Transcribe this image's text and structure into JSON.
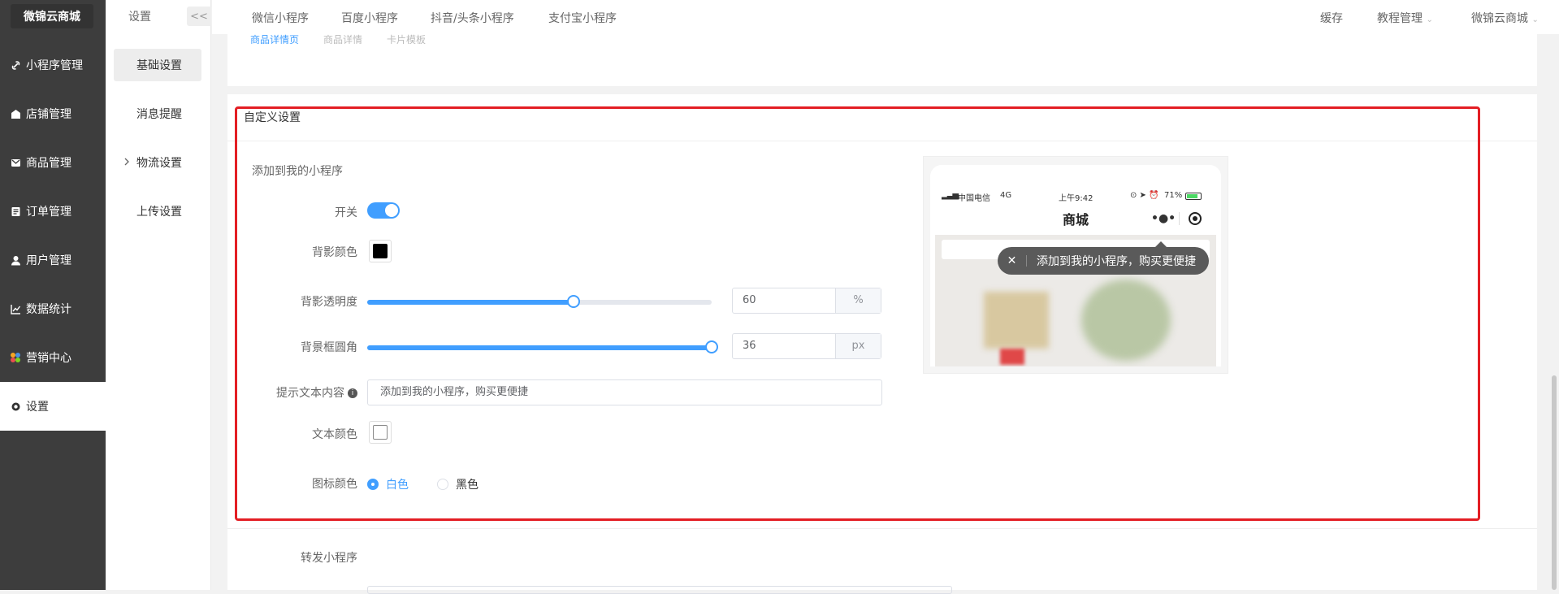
{
  "app": {
    "brand": "微锦云商城"
  },
  "sidebar": {
    "items": [
      {
        "label": "小程序管理",
        "icon": "link-icon"
      },
      {
        "label": "店铺管理",
        "icon": "store-icon"
      },
      {
        "label": "商品管理",
        "icon": "goods-icon"
      },
      {
        "label": "订单管理",
        "icon": "order-icon"
      },
      {
        "label": "用户管理",
        "icon": "user-icon"
      },
      {
        "label": "数据统计",
        "icon": "chart-icon"
      },
      {
        "label": "营销中心",
        "icon": "marketing-icon"
      },
      {
        "label": "设置",
        "icon": "gear-icon"
      }
    ]
  },
  "secondary": {
    "title": "设置",
    "collapse": "<<",
    "items": [
      {
        "label": "基础设置"
      },
      {
        "label": "消息提醒"
      },
      {
        "label": "物流设置"
      },
      {
        "label": "上传设置"
      }
    ]
  },
  "topbar": {
    "tabs": [
      "微信小程序",
      "百度小程序",
      "抖音/头条小程序",
      "支付宝小程序"
    ],
    "right": [
      "缓存",
      "教程管理",
      "微锦云商城"
    ]
  },
  "partial_row": [
    "商品详情页",
    "商品详情",
    "卡片模板"
  ],
  "custom": {
    "title": "自定义设置",
    "section": "添加到我的小程序",
    "switch_label": "开关",
    "bg_color_label": "背影颜色",
    "opacity_label": "背影透明度",
    "opacity_value": "60",
    "opacity_unit": "%",
    "radius_label": "背景框圆角",
    "radius_value": "36",
    "radius_unit": "px",
    "tip_label": "提示文本内容",
    "tip_value": "添加到我的小程序，购买更便捷",
    "text_color_label": "文本颜色",
    "icon_color_label": "图标颜色",
    "icon_options": [
      "白色",
      "黑色"
    ],
    "switch_on": true,
    "bg_color": "#000000",
    "text_color": "#ffffff",
    "accent": "#409eff",
    "opacity_fraction": 0.6,
    "radius_fraction": 1.0
  },
  "preview": {
    "carrier": "中国电信",
    "network": "4G",
    "time": "上午9:42",
    "battery": "71%",
    "title": "商城",
    "tip": "添加到我的小程序，购买更便捷"
  },
  "forward": {
    "label": "转发小程序"
  }
}
